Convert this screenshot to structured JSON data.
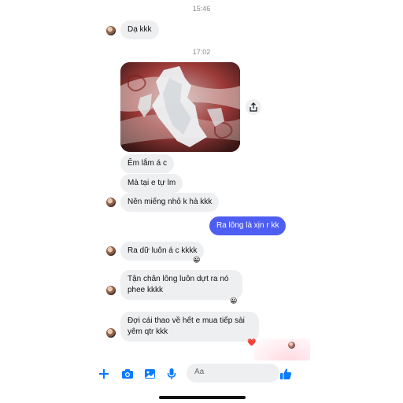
{
  "conversation": {
    "timestamps": [
      "15:46",
      "17:02"
    ],
    "messages_in_1": "Dạ kkk",
    "msg_em": "Êm lắm á c",
    "msg_tu_lm": "Mà tại e tự lm",
    "msg_nho": "Nên miếng nhỏ k hà kkk",
    "msg_out": "Ra lông là xịn r kk",
    "msg_du": "Ra dữ luôn á c kkkk",
    "msg_tan_chan": "Tận chân lông luôn dựt ra nó phee kkkk",
    "msg_doi": "Đợi cái thao về hết e mua tiếp sài yêm qtr kkk",
    "reaction_smile": "😀",
    "reaction_heart": "❤️"
  },
  "composer": {
    "placeholder": "Aa",
    "icons": [
      "plus-icon",
      "camera-icon",
      "gallery-icon",
      "microphone-icon",
      "emoji-icon",
      "like-icon"
    ]
  },
  "colors": {
    "outgoing_bubble": "#4f5ef2",
    "incoming_bubble": "#eeeff1",
    "accent": "#0a7cff"
  },
  "media": {
    "photo": "photo-attachment",
    "share_icon": "share-icon"
  }
}
